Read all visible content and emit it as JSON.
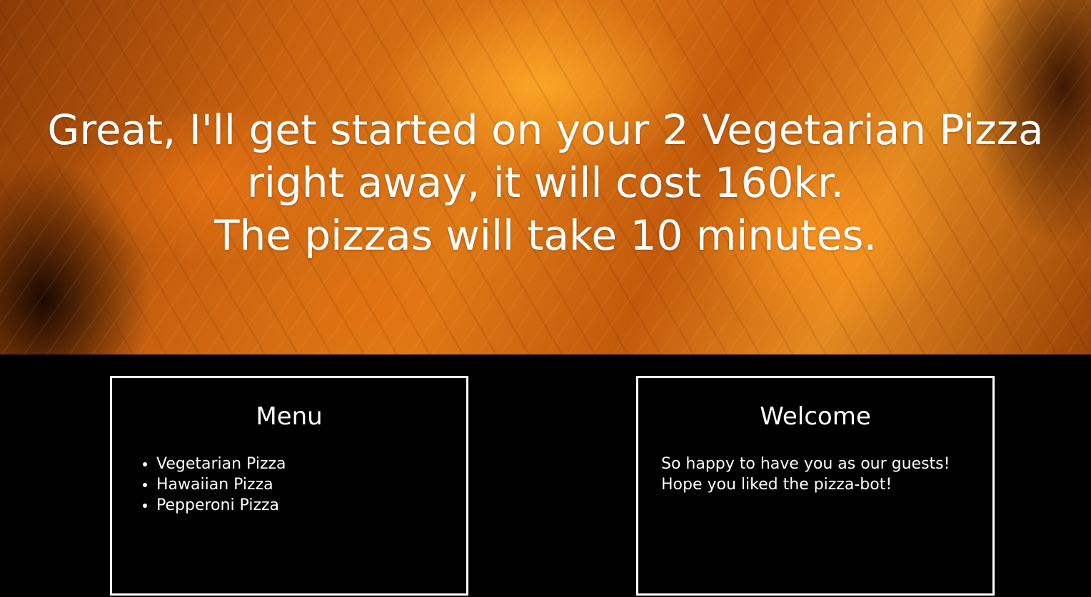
{
  "hero": {
    "line1": "Great, I'll get started on your 2 Vegetarian Pizza",
    "line2": "right away, it will cost 160kr.",
    "line3": "The pizzas will take 10 minutes."
  },
  "menu": {
    "title": "Menu",
    "items": [
      "Vegetarian Pizza",
      "Hawaiian Pizza",
      "Pepperoni Pizza"
    ]
  },
  "welcome": {
    "title": "Welcome",
    "line1": "So happy to have you as our guests!",
    "line2": "Hope you liked the pizza-bot!"
  },
  "colors": {
    "background": "#000000",
    "text": "#ffffff",
    "accent": "#e07a16"
  }
}
